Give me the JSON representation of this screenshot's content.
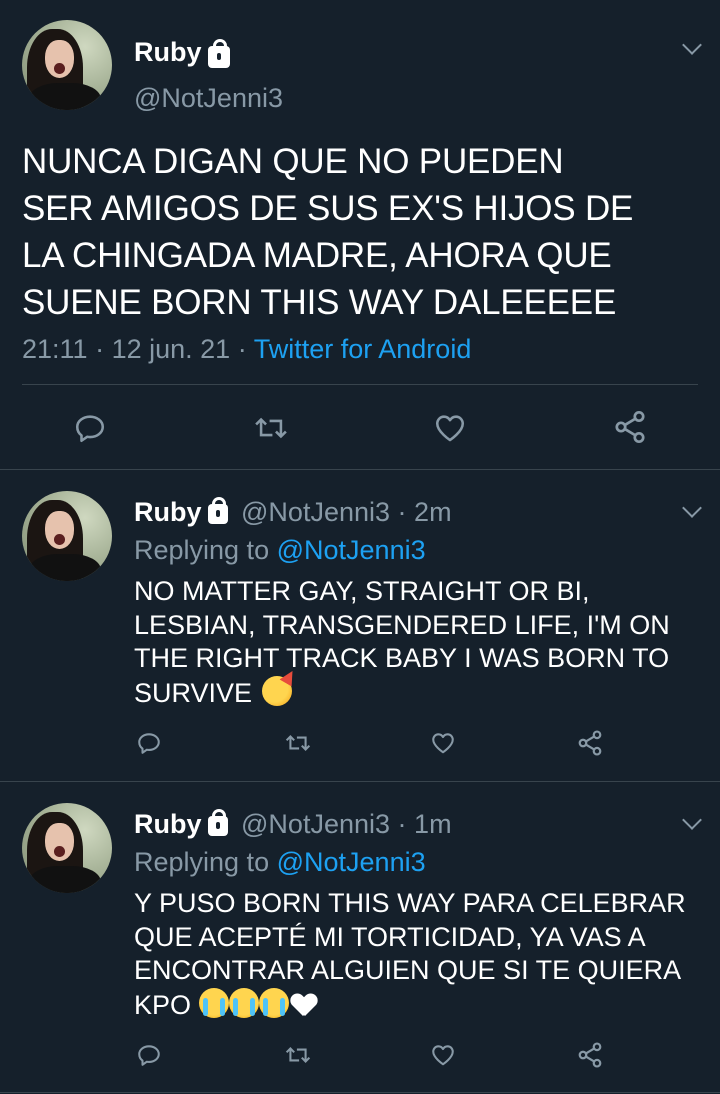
{
  "main_tweet": {
    "display_name": "Ruby",
    "handle": "@NotJenni3",
    "text_lines": [
      "NUNCA DIGAN QUE NO PUEDEN",
      "SER AMIGOS DE SUS EX'S HIJOS DE",
      "LA CHINGADA MADRE, AHORA QUE",
      "SUENE BORN THIS WAY DALEEEEE"
    ],
    "time": "21:11",
    "date": "12 jun. 21",
    "source": "Twitter for Android",
    "sep": "·"
  },
  "replies": [
    {
      "display_name": "Ruby",
      "handle": "@NotJenni3",
      "age": "2m",
      "replying_label": "Replying to",
      "replying_to": "@NotJenni3",
      "text_lines": [
        "NO MATTER GAY, STRAIGHT OR BI,",
        "LESBIAN, TRANSGENDERED LIFE, I'M ON",
        "THE RIGHT TRACK BABY I WAS BORN TO",
        "SURVIVE"
      ],
      "emojis": [
        "partying-face"
      ]
    },
    {
      "display_name": "Ruby",
      "handle": "@NotJenni3",
      "age": "1m",
      "replying_label": "Replying to",
      "replying_to": "@NotJenni3",
      "text_lines": [
        "Y PUSO BORN THIS WAY PARA CELEBRAR",
        "QUE ACEPTÉ MI TORTICIDAD, YA VAS A",
        "ENCONTRAR ALGUIEN QUE SI TE QUIERA",
        "KPO"
      ],
      "emojis": [
        "loudly-crying-face",
        "loudly-crying-face",
        "loudly-crying-face",
        "white-heart"
      ]
    }
  ],
  "colors": {
    "background": "#15202b",
    "text": "#ffffff",
    "muted": "#8899a6",
    "accent": "#1da1f2",
    "divider": "#38444d"
  },
  "icons": [
    "chevron-down-icon",
    "reply-icon",
    "retweet-icon",
    "like-icon",
    "share-icon",
    "lock-icon"
  ]
}
